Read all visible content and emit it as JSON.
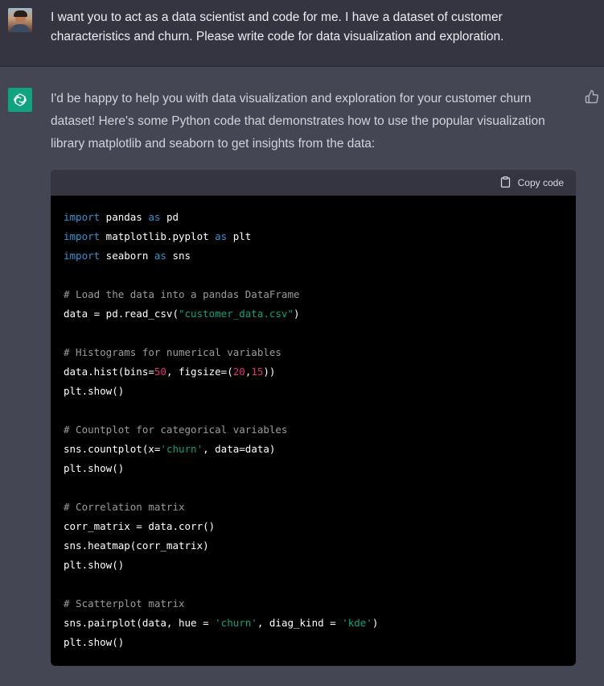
{
  "user": {
    "avatar_icon": "user-avatar-photo",
    "message": "I want you to act as a data scientist and code for me. I have a dataset of customer characteristics and churn. Please write code for data visualization and exploration."
  },
  "assistant": {
    "avatar_icon": "openai-logo-icon",
    "avatar_color": "#10a37f",
    "message": "I'd be happy to help you with data visualization and exploration for your customer churn dataset! Here's some Python code that demonstrates how to use the popular visualization library matplotlib and seaborn to get insights from the data:",
    "feedback_icon": "thumbs-up-icon"
  },
  "code": {
    "copy_label": "Copy code",
    "copy_icon": "clipboard-icon",
    "lines": [
      {
        "segments": [
          {
            "t": "import",
            "c": "kw"
          },
          {
            "t": " pandas ",
            "c": ""
          },
          {
            "t": "as",
            "c": "kw"
          },
          {
            "t": " pd",
            "c": ""
          }
        ]
      },
      {
        "segments": [
          {
            "t": "import",
            "c": "kw"
          },
          {
            "t": " matplotlib.pyplot ",
            "c": ""
          },
          {
            "t": "as",
            "c": "kw"
          },
          {
            "t": " plt",
            "c": ""
          }
        ]
      },
      {
        "segments": [
          {
            "t": "import",
            "c": "kw"
          },
          {
            "t": " seaborn ",
            "c": ""
          },
          {
            "t": "as",
            "c": "kw"
          },
          {
            "t": " sns",
            "c": ""
          }
        ]
      },
      {
        "segments": []
      },
      {
        "segments": [
          {
            "t": "# Load the data into a pandas DataFrame",
            "c": "cm"
          }
        ]
      },
      {
        "segments": [
          {
            "t": "data = pd.read_csv(",
            "c": ""
          },
          {
            "t": "\"customer_data.csv\"",
            "c": "str"
          },
          {
            "t": ")",
            "c": ""
          }
        ]
      },
      {
        "segments": []
      },
      {
        "segments": [
          {
            "t": "# Histograms for numerical variables",
            "c": "cm"
          }
        ]
      },
      {
        "segments": [
          {
            "t": "data.hist(bins=",
            "c": ""
          },
          {
            "t": "50",
            "c": "num"
          },
          {
            "t": ", figsize=(",
            "c": ""
          },
          {
            "t": "20",
            "c": "num"
          },
          {
            "t": ",",
            "c": ""
          },
          {
            "t": "15",
            "c": "num"
          },
          {
            "t": "))",
            "c": ""
          }
        ]
      },
      {
        "segments": [
          {
            "t": "plt.show()",
            "c": ""
          }
        ]
      },
      {
        "segments": []
      },
      {
        "segments": [
          {
            "t": "# Countplot for categorical variables",
            "c": "cm"
          }
        ]
      },
      {
        "segments": [
          {
            "t": "sns.countplot(x=",
            "c": ""
          },
          {
            "t": "'churn'",
            "c": "str"
          },
          {
            "t": ", data=data)",
            "c": ""
          }
        ]
      },
      {
        "segments": [
          {
            "t": "plt.show()",
            "c": ""
          }
        ]
      },
      {
        "segments": []
      },
      {
        "segments": [
          {
            "t": "# Correlation matrix",
            "c": "cm"
          }
        ]
      },
      {
        "segments": [
          {
            "t": "corr_matrix = data.corr()",
            "c": ""
          }
        ]
      },
      {
        "segments": [
          {
            "t": "sns.heatmap(corr_matrix)",
            "c": ""
          }
        ]
      },
      {
        "segments": [
          {
            "t": "plt.show()",
            "c": ""
          }
        ]
      },
      {
        "segments": []
      },
      {
        "segments": [
          {
            "t": "# Scatterplot matrix",
            "c": "cm"
          }
        ]
      },
      {
        "segments": [
          {
            "t": "sns.pairplot(data, hue = ",
            "c": ""
          },
          {
            "t": "'churn'",
            "c": "str"
          },
          {
            "t": ", diag_kind = ",
            "c": ""
          },
          {
            "t": "'kde'",
            "c": "str"
          },
          {
            "t": ")",
            "c": ""
          }
        ]
      },
      {
        "segments": [
          {
            "t": "plt.show()",
            "c": ""
          }
        ]
      }
    ]
  }
}
